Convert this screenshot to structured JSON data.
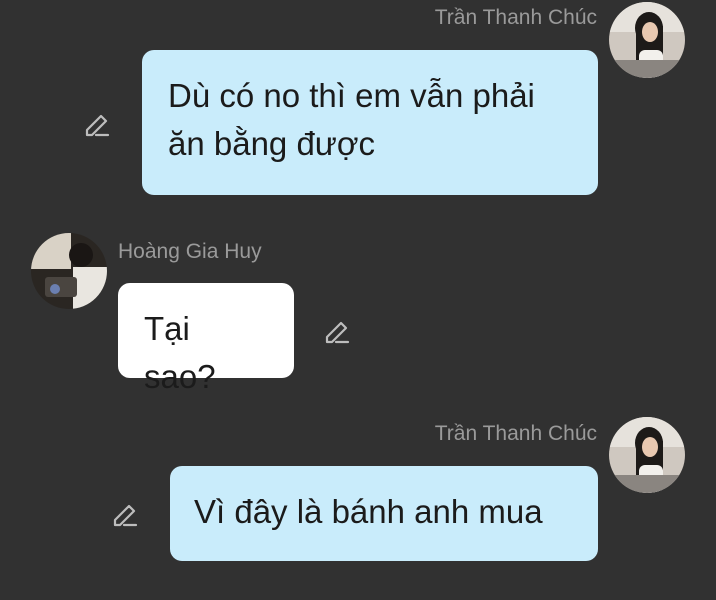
{
  "theme": {
    "background": "#313131",
    "my_bubble": "#c9ecfb",
    "their_bubble": "#ffffff",
    "name_color": "#9a9a9a",
    "icon_color": "#bdbdbd"
  },
  "messages": [
    {
      "sender": "Trần Thanh Chúc",
      "text_lines": [
        "Dù có no thì em vẫn phải",
        "ăn bằng được"
      ],
      "side": "right",
      "avatar": "user-avatar-tran-thanh-chuc",
      "action_icon": "edit-pencil-icon"
    },
    {
      "sender": "Hoàng Gia Huy",
      "text_lines": [
        "Tại sao?"
      ],
      "side": "left",
      "avatar": "user-avatar-hoang-gia-huy",
      "action_icon": "edit-pencil-icon"
    },
    {
      "sender": "Trần Thanh Chúc",
      "text_lines": [
        "Vì đây là bánh anh mua"
      ],
      "side": "right",
      "avatar": "user-avatar-tran-thanh-chuc",
      "action_icon": "edit-pencil-icon"
    }
  ]
}
